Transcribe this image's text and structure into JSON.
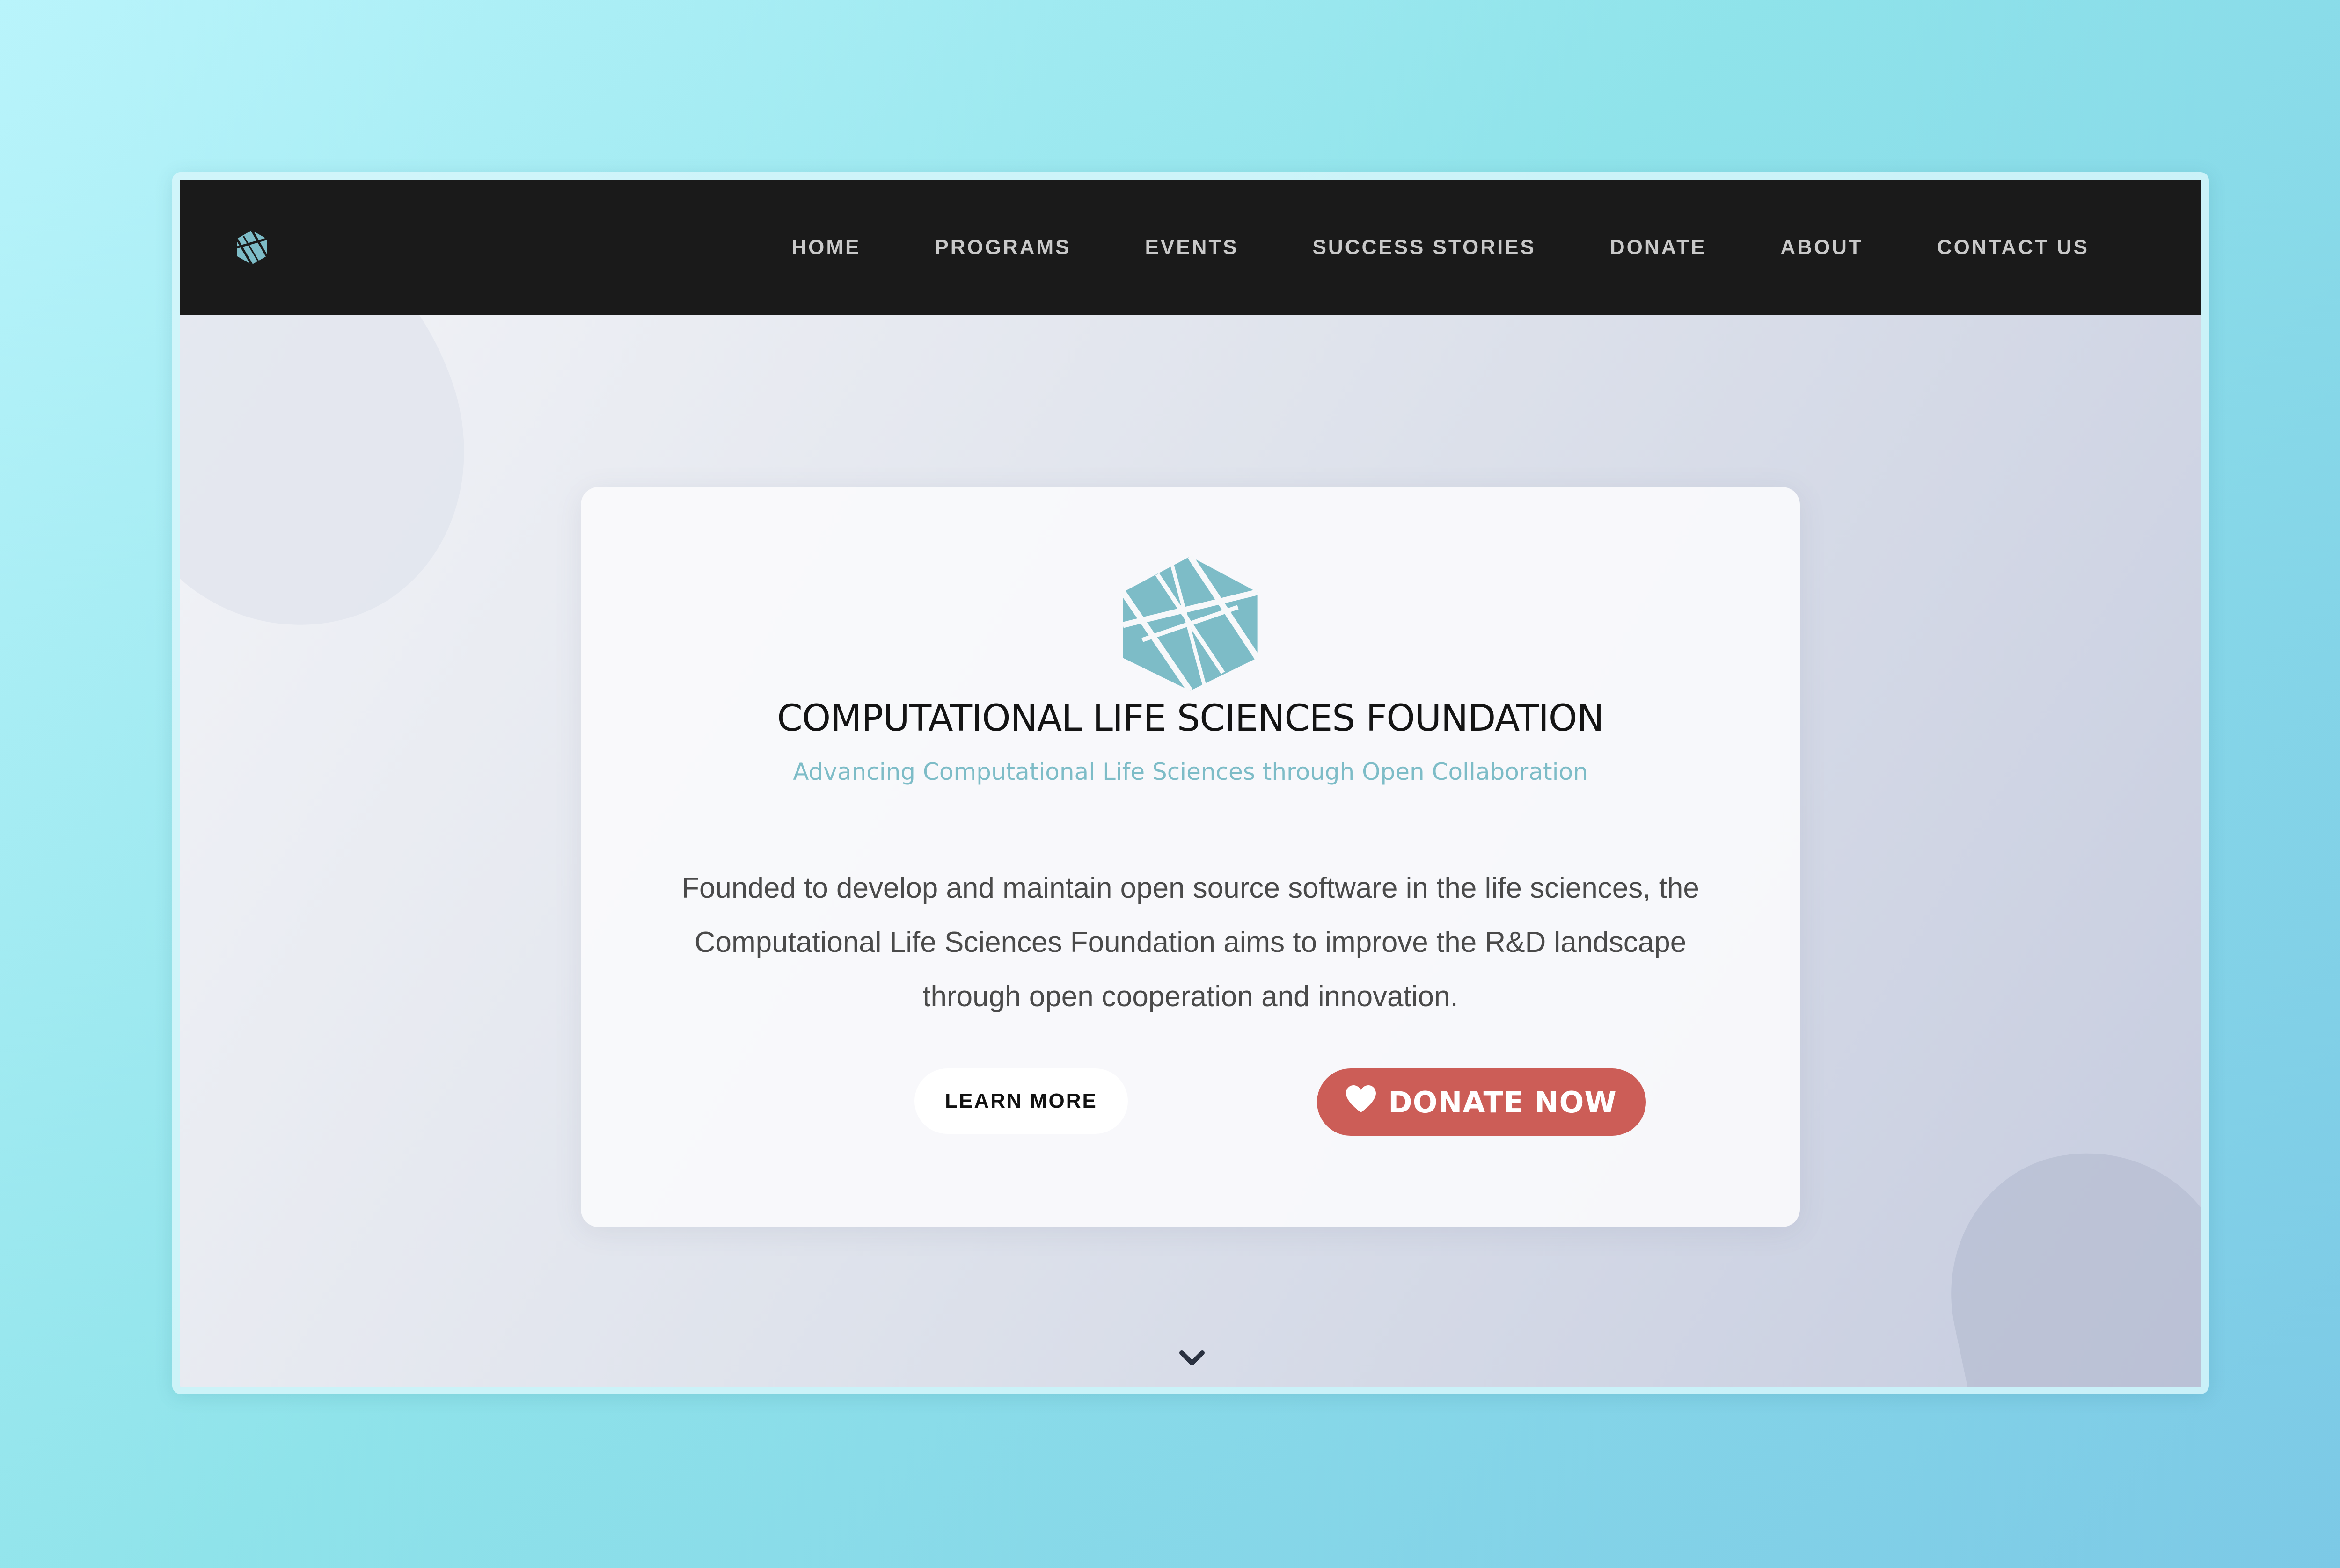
{
  "colors": {
    "accent": "#7dbcc7",
    "navbar_bg": "#1a1a1a",
    "donate_button": "#cc5d57"
  },
  "navbar": {
    "logo_icon": "hexagon-knot-logo-icon",
    "links": [
      {
        "label": "HOME"
      },
      {
        "label": "PROGRAMS"
      },
      {
        "label": "EVENTS"
      },
      {
        "label": "SUCCESS STORIES"
      },
      {
        "label": "DONATE"
      },
      {
        "label": "ABOUT"
      },
      {
        "label": "CONTACT US"
      }
    ]
  },
  "hero": {
    "logo_icon": "hexagon-knot-logo-icon",
    "title": "COMPUTATIONAL LIFE SCIENCES FOUNDATION",
    "subtitle": "Advancing Computational Life Sciences through Open Collaboration",
    "description": "Founded to develop and maintain open source software in the life sciences, the Computational Life Sciences Foundation aims to improve the R&D landscape through open cooperation and innovation.",
    "learn_more_label": "LEARN MORE",
    "donate_label": "DONATE NOW",
    "donate_icon": "heart-icon",
    "scroll_icon": "chevron-down-icon"
  }
}
